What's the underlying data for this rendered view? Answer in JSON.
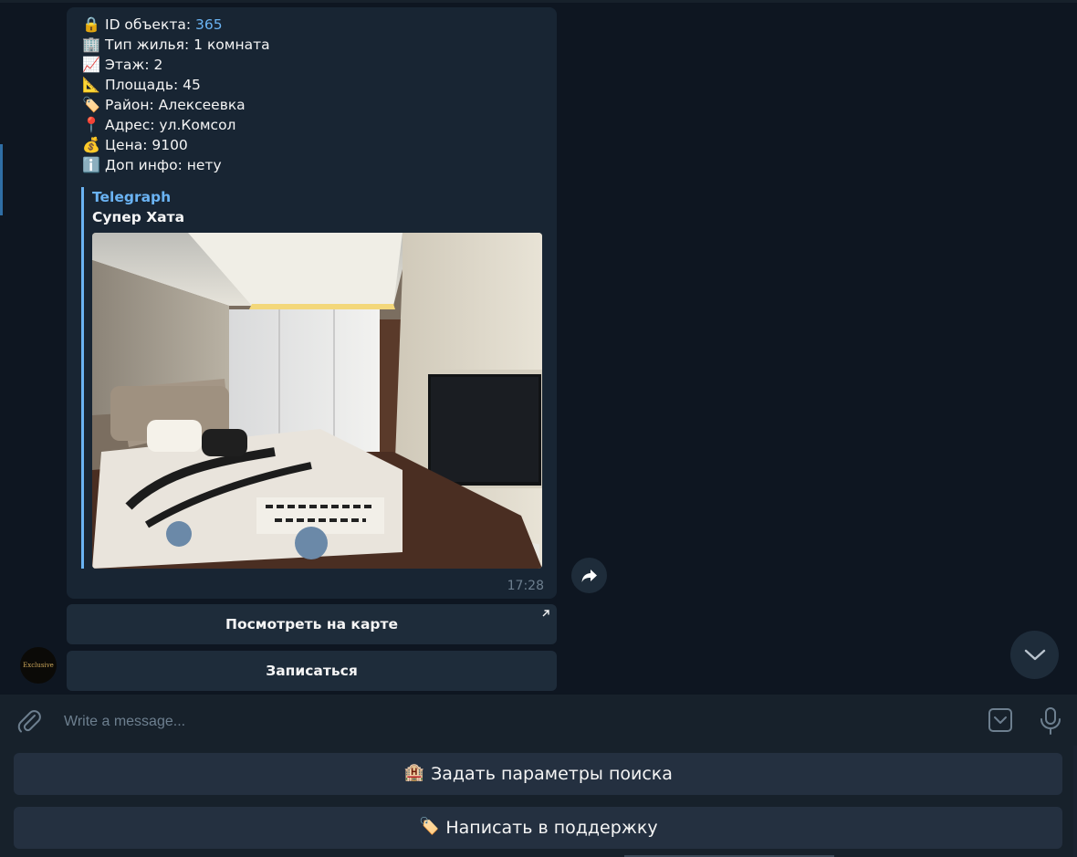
{
  "message": {
    "info_lines": [
      {
        "icon": "lock-icon",
        "glyph": "🔒",
        "label": "ID объекта: ",
        "value": "365"
      },
      {
        "icon": "building-icon",
        "glyph": "🏢",
        "text": "Тип жилья: 1 комната"
      },
      {
        "icon": "chart-increasing-icon",
        "glyph": "📈",
        "text": "Этаж: 2"
      },
      {
        "icon": "triangular-ruler-icon",
        "glyph": "📐",
        "text": "Площадь: 45"
      },
      {
        "icon": "label-tag-icon",
        "glyph": "🏷️",
        "text": "Район: Алексеевка"
      },
      {
        "icon": "round-pushpin-icon",
        "glyph": "📍",
        "text": "Адрес: ул.Комсол"
      },
      {
        "icon": "money-bag-icon",
        "glyph": "💰",
        "text": "Цена: 9100"
      },
      {
        "icon": "information-icon",
        "glyph": "ℹ️",
        "text": "Доп инфо: нету"
      }
    ],
    "link_preview": {
      "site": "Telegraph",
      "title": "Супер Хата"
    },
    "time": "17:28"
  },
  "inline_buttons": {
    "map": "Посмотреть на карте",
    "signup": "Записаться"
  },
  "composer": {
    "placeholder": "Write a message..."
  },
  "reply_keyboard": [
    {
      "icon": "house-icon",
      "glyph": "🏨",
      "label": "Задать параметры поиска"
    },
    {
      "icon": "label-tag-icon",
      "glyph": "🏷️",
      "label": "Написать в поддержку"
    }
  ],
  "bot_avatar_text": "Exclusive",
  "colors": {
    "background": "#0e1621",
    "bubble": "#182533",
    "link": "#6ab3f3",
    "button": "#1e2c3a",
    "keyboard_button": "#243040",
    "muted": "#6d7f8f"
  }
}
